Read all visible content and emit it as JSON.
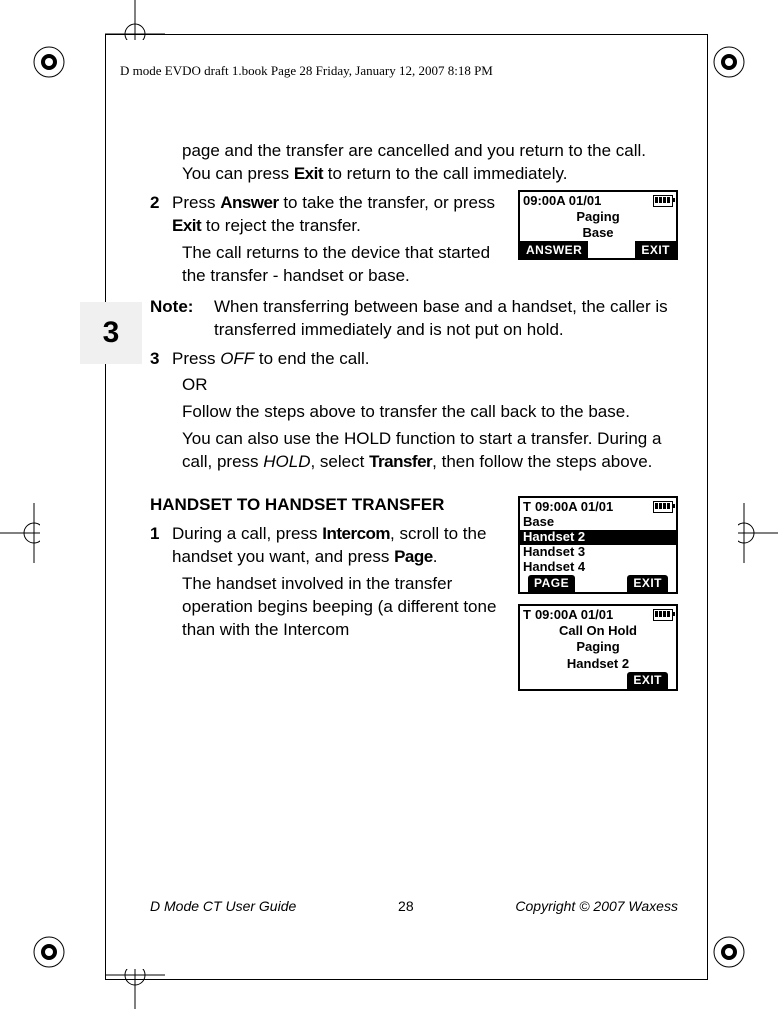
{
  "header": "D mode EVDO draft 1.book  Page 28  Friday, January 12, 2007  8:18 PM",
  "chapter": "3",
  "para_top": "page and the transfer are cancelled and you return to the call. You can press ",
  "para_top_word": "Exit",
  "para_top_tail": " to return to the call immediately.",
  "step2": {
    "num": "2",
    "a": "Press ",
    "answer": "Answer",
    "b": " to take the transfer, or press ",
    "exit": "Exit",
    "c": " to reject the transfer.",
    "detail": "The call returns to the device that started the transfer - handset or base."
  },
  "note": {
    "label": "Note:",
    "text": "When transferring between base and a handset, the caller is transferred immediately and is not put on hold."
  },
  "step3": {
    "num": "3",
    "a": "Press ",
    "off": "OFF",
    "b": " to end the call.",
    "or": "OR",
    "follow": "Follow the steps above to transfer the call back to the base.",
    "youcan_a": "You can also use the HOLD function to start a transfer. During a call, press ",
    "hold": "HOLD",
    "youcan_b": ", select ",
    "transfer": "Transfer",
    "youcan_c": ", then follow the steps above."
  },
  "h2": "HANDSET TO HANDSET TRANSFER",
  "h_step1": {
    "num": "1",
    "a": "During a call, press ",
    "intercom": "Intercom",
    "b": ", scroll to the handset you want, and press ",
    "page": "Page",
    "c": ".",
    "detail": "The handset involved in the transfer operation begins beeping (a different tone than with the Intercom"
  },
  "lcd1": {
    "time": "09:00A 01/01",
    "l1": "Paging",
    "l2": "Base",
    "sk_left": "ANSWER",
    "sk_right": "EXIT"
  },
  "lcd2": {
    "prefix": "T",
    "time": "09:00A 01/01",
    "rows": [
      "Base",
      "Handset 2",
      "Handset 3",
      "Handset 4"
    ],
    "selected": 1,
    "sk_left": "PAGE",
    "sk_right": "EXIT"
  },
  "lcd3": {
    "prefix": "T",
    "time": "09:00A 01/01",
    "l1": "Call On Hold",
    "l2": "Paging",
    "l3": "Handset 2",
    "sk_right": "EXIT"
  },
  "footer": {
    "left": "D Mode CT User Guide",
    "page": "28",
    "right": "Copyright © 2007 Waxess"
  }
}
